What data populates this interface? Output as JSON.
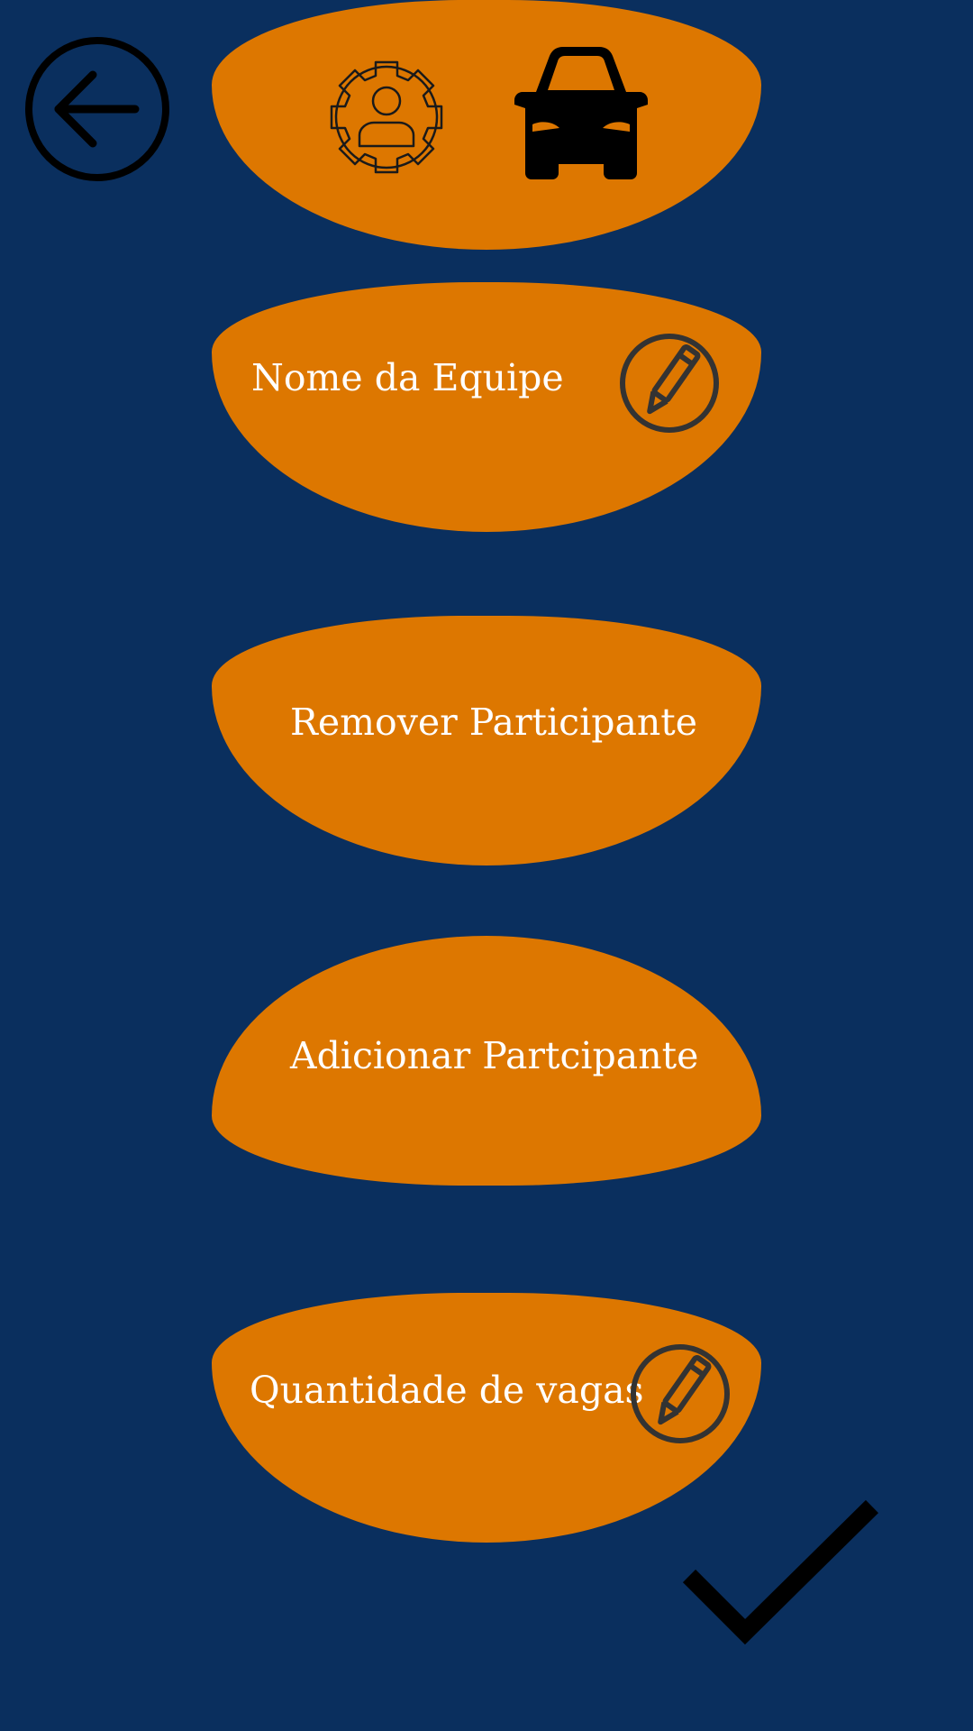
{
  "header": {
    "settings_icon": "user-gear-icon",
    "car_icon": "car-icon"
  },
  "navigation": {
    "back_icon": "arrow-left-circle-icon"
  },
  "menu": {
    "team_name_label": "Nome da Equipe",
    "remove_participant_label": "Remover Participante",
    "add_participant_label": "Adicionar Partcipante",
    "vacancies_label": "Quantidade de vagas",
    "edit_icon": "pencil-circle-icon"
  },
  "actions": {
    "confirm_icon": "checkmark-icon"
  },
  "colors": {
    "background": "#0a2f5e",
    "button": "#dd7700",
    "text": "#ffffff",
    "icon_dark": "#000000",
    "edit_icon": "#333333"
  }
}
